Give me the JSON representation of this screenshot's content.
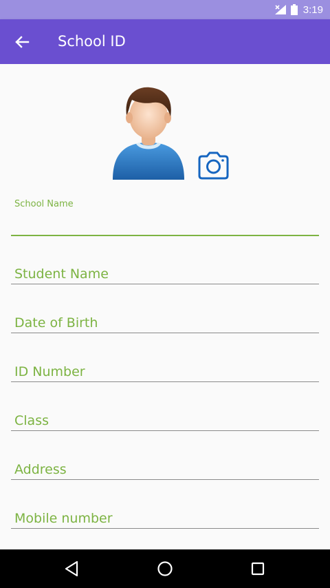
{
  "status_bar": {
    "time": "3:19",
    "icons": [
      "signal-icon",
      "battery-icon"
    ]
  },
  "app_bar": {
    "title": "School ID",
    "back_icon": "arrow-back-icon",
    "color": "#6a4fd0"
  },
  "profile": {
    "avatar": "avatar-icon",
    "camera_icon": "camera-icon",
    "accent": "#1565c0"
  },
  "form": {
    "fields": [
      {
        "label": "School Name",
        "value": "",
        "focused": true
      },
      {
        "label": "Student Name",
        "value": ""
      },
      {
        "label": "Date of Birth",
        "value": ""
      },
      {
        "label": "ID Number",
        "value": ""
      },
      {
        "label": "Class",
        "value": ""
      },
      {
        "label": "Address",
        "value": ""
      },
      {
        "label": "Mobile number",
        "value": ""
      }
    ],
    "accent_color": "#7cb342"
  },
  "nav_bar": {
    "buttons": [
      "back-icon",
      "home-icon",
      "recents-icon"
    ]
  }
}
